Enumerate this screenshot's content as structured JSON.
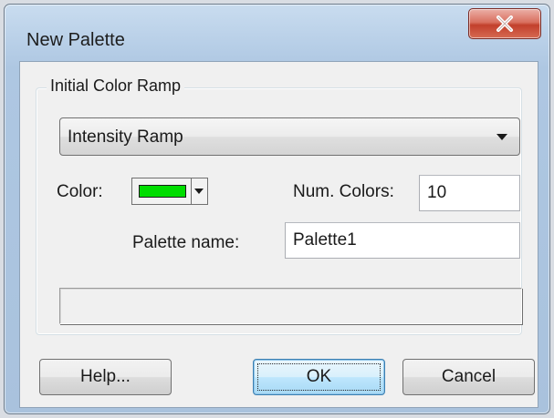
{
  "window": {
    "title": "New Palette",
    "close_icon": "close-x-icon"
  },
  "group": {
    "legend": "Initial Color Ramp"
  },
  "ramp_combo": {
    "selected": "Intensity Ramp",
    "arrow_icon": "chevron-down-icon"
  },
  "color": {
    "label": "Color:",
    "swatch_color": "#00dd00",
    "arrow_icon": "chevron-down-icon"
  },
  "num_colors": {
    "label": "Num. Colors:",
    "value": "10"
  },
  "palette_name": {
    "label": "Palette name:",
    "value": "Palette1"
  },
  "buttons": {
    "help": "Help...",
    "ok": "OK",
    "cancel": "Cancel"
  },
  "colors": {
    "title_bar": "#b9d0e8",
    "close_button": "#c2402c",
    "default_button": "#bee6fd",
    "dialog_face": "#f0f0f0"
  }
}
